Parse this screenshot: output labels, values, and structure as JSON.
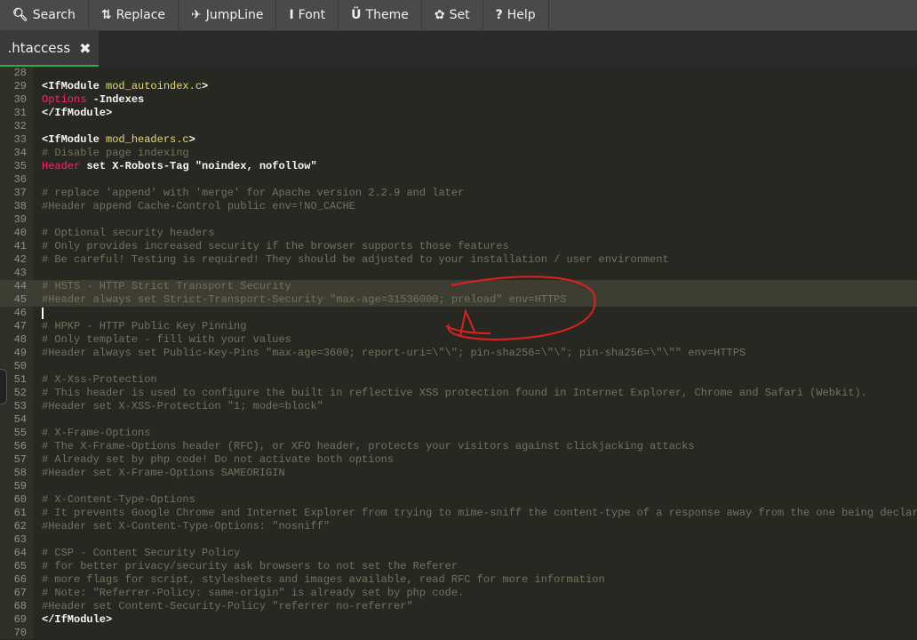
{
  "toolbar": {
    "items": [
      {
        "icon": "🔍︎",
        "label": "Search",
        "name": "search"
      },
      {
        "icon": "⇅",
        "label": "Replace",
        "name": "replace"
      },
      {
        "icon": "✈︎",
        "label": "JumpLine",
        "name": "jumpline"
      },
      {
        "icon": "I",
        "label": "Font",
        "name": "font"
      },
      {
        "icon": "Ü",
        "label": "Theme",
        "name": "theme"
      },
      {
        "icon": "✿",
        "label": "Set",
        "name": "set"
      },
      {
        "icon": "?",
        "label": "Help",
        "name": "help"
      }
    ]
  },
  "tab": {
    "label": ".htaccess",
    "close": "✖"
  },
  "highlighted_lines": [
    44,
    45
  ],
  "cursor_line": 46,
  "lines": [
    {
      "n": "28",
      "s": []
    },
    {
      "n": "29",
      "s": [
        [
          "text",
          "<IfModule "
        ],
        [
          "attr",
          "mod_autoindex.c"
        ],
        [
          "text",
          ">"
        ]
      ]
    },
    {
      "n": "30",
      "s": [
        [
          "keyword",
          "Options"
        ],
        [
          "text",
          " -Indexes"
        ]
      ]
    },
    {
      "n": "31",
      "s": [
        [
          "text",
          "</IfModule>"
        ]
      ]
    },
    {
      "n": "32",
      "s": []
    },
    {
      "n": "33",
      "s": [
        [
          "text",
          "<IfModule "
        ],
        [
          "attr",
          "mod_headers.c"
        ],
        [
          "text",
          ">"
        ]
      ]
    },
    {
      "n": "34",
      "s": [
        [
          "comment",
          "# Disable page indexing"
        ]
      ]
    },
    {
      "n": "35",
      "s": [
        [
          "keyword",
          "Header"
        ],
        [
          "text",
          " set X-Robots-Tag \"noindex, nofollow\""
        ]
      ]
    },
    {
      "n": "36",
      "s": []
    },
    {
      "n": "37",
      "s": [
        [
          "comment",
          "# replace 'append' with 'merge' for Apache version 2.2.9 and later"
        ]
      ]
    },
    {
      "n": "38",
      "s": [
        [
          "comment",
          "#Header append Cache-Control public env=!NO_CACHE"
        ]
      ]
    },
    {
      "n": "39",
      "s": []
    },
    {
      "n": "40",
      "s": [
        [
          "comment",
          "# Optional security headers"
        ]
      ]
    },
    {
      "n": "41",
      "s": [
        [
          "comment",
          "# Only provides increased security if the browser supports those features"
        ]
      ]
    },
    {
      "n": "42",
      "s": [
        [
          "comment",
          "# Be careful! Testing is required! They should be adjusted to your installation / user environment"
        ]
      ]
    },
    {
      "n": "43",
      "s": []
    },
    {
      "n": "44",
      "s": [
        [
          "comment",
          "# HSTS - HTTP Strict Transport Security"
        ]
      ]
    },
    {
      "n": "45",
      "s": [
        [
          "comment",
          "#Header always set Strict-Transport-Security \"max-age=31536000; preload\" env=HTTPS"
        ]
      ]
    },
    {
      "n": "46",
      "s": []
    },
    {
      "n": "47",
      "s": [
        [
          "comment",
          "# HPKP - HTTP Public Key Pinning"
        ]
      ]
    },
    {
      "n": "48",
      "s": [
        [
          "comment",
          "# Only template - fill with your values"
        ]
      ]
    },
    {
      "n": "49",
      "s": [
        [
          "comment",
          "#Header always set Public-Key-Pins \"max-age=3600; report-uri=\\\"\\\"; pin-sha256=\\\"\\\"; pin-sha256=\\\"\\\"\" env=HTTPS"
        ]
      ]
    },
    {
      "n": "50",
      "s": []
    },
    {
      "n": "51",
      "s": [
        [
          "comment",
          "# X-Xss-Protection"
        ]
      ]
    },
    {
      "n": "52",
      "s": [
        [
          "comment",
          "# This header is used to configure the built in reflective XSS protection found in Internet Explorer, Chrome and Safari (Webkit)."
        ]
      ]
    },
    {
      "n": "53",
      "s": [
        [
          "comment",
          "#Header set X-XSS-Protection \"1; mode=block\""
        ]
      ]
    },
    {
      "n": "54",
      "s": []
    },
    {
      "n": "55",
      "s": [
        [
          "comment",
          "# X-Frame-Options"
        ]
      ]
    },
    {
      "n": "56",
      "s": [
        [
          "comment",
          "# The X-Frame-Options header (RFC), or XFO header, protects your visitors against clickjacking attacks"
        ]
      ]
    },
    {
      "n": "57",
      "s": [
        [
          "comment",
          "# Already set by php code! Do not activate both options"
        ]
      ]
    },
    {
      "n": "58",
      "s": [
        [
          "comment",
          "#Header set X-Frame-Options SAMEORIGIN"
        ]
      ]
    },
    {
      "n": "59",
      "s": []
    },
    {
      "n": "60",
      "s": [
        [
          "comment",
          "# X-Content-Type-Options"
        ]
      ]
    },
    {
      "n": "61",
      "s": [
        [
          "comment",
          "# It prevents Google Chrome and Internet Explorer from trying to mime-sniff the content-type of a response away from the one being declare"
        ]
      ]
    },
    {
      "n": "62",
      "s": [
        [
          "comment",
          "#Header set X-Content-Type-Options: \"nosniff\""
        ]
      ]
    },
    {
      "n": "63",
      "s": []
    },
    {
      "n": "64",
      "s": [
        [
          "comment",
          "# CSP - Content Security Policy"
        ]
      ]
    },
    {
      "n": "65",
      "s": [
        [
          "comment",
          "# for better privacy/security ask browsers to not set the Referer"
        ]
      ]
    },
    {
      "n": "66",
      "s": [
        [
          "comment",
          "# more flags for script, stylesheets and images available, read RFC for more information"
        ]
      ]
    },
    {
      "n": "67",
      "s": [
        [
          "comment",
          "# Note: \"Referrer-Policy: same-origin\" is already set by php code."
        ]
      ]
    },
    {
      "n": "68",
      "s": [
        [
          "comment",
          "#Header set Content-Security-Policy \"referrer no-referrer\""
        ]
      ]
    },
    {
      "n": "69",
      "s": [
        [
          "text",
          "</IfModule>"
        ]
      ]
    },
    {
      "n": "70",
      "s": []
    }
  ],
  "colors": {
    "comment": "#75715e",
    "keyword": "#f92672",
    "attr": "#e6db74",
    "text": "#f8f8f2",
    "annotation": "#e0201c",
    "tab_accent": "#2fa84f"
  }
}
